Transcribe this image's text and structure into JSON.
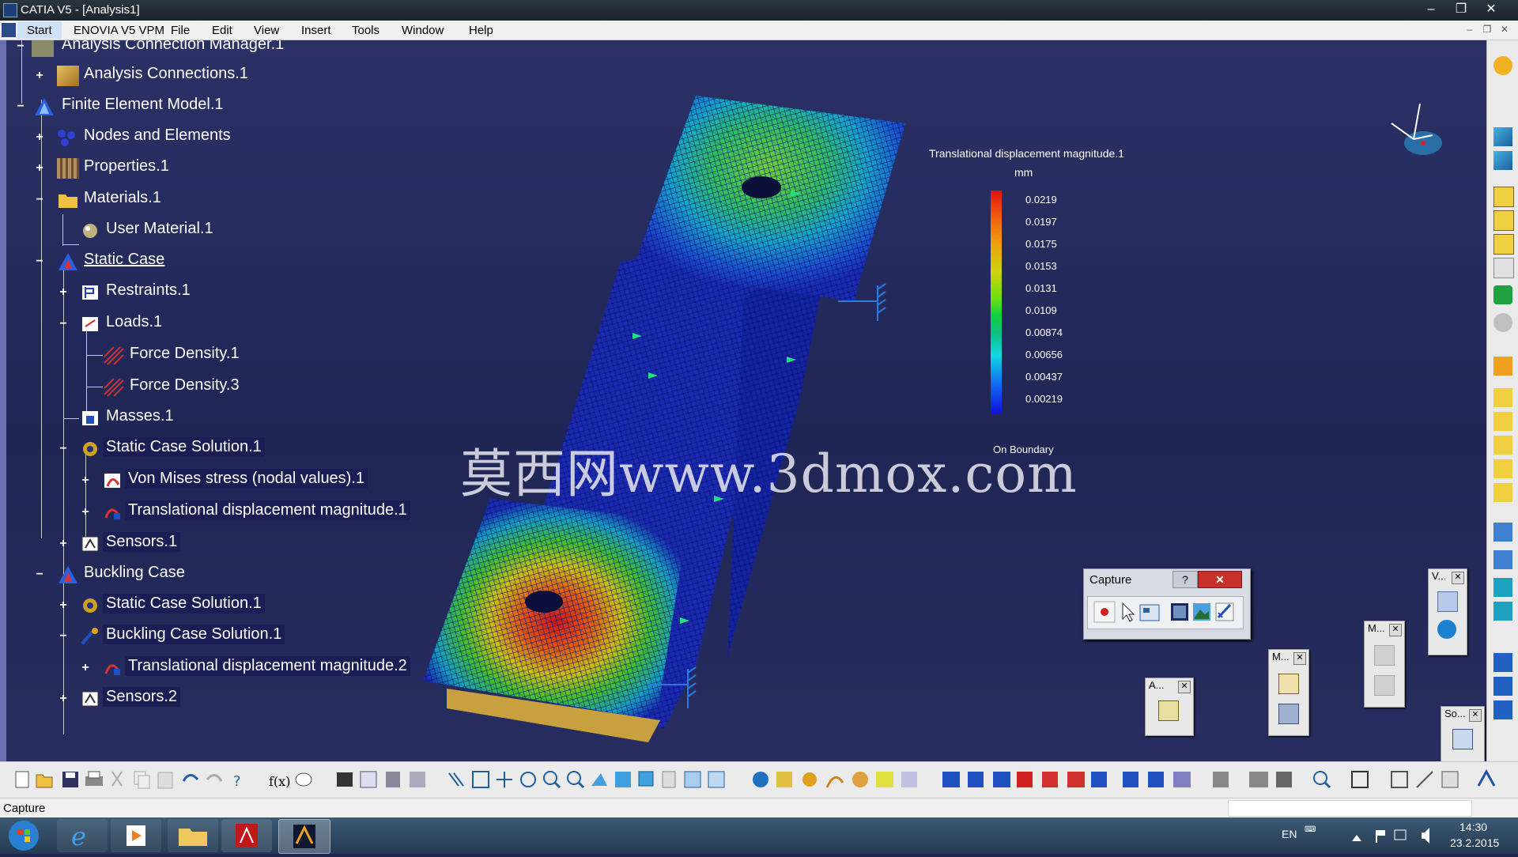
{
  "window": {
    "title": "CATIA V5 - [Analysis1]",
    "controls": {
      "minimize": "–",
      "maximize": "❐",
      "close": "✕"
    }
  },
  "menubar": {
    "items": [
      "Start",
      "ENOVIA V5 VPM",
      "File",
      "Edit",
      "View",
      "Insert",
      "Tools",
      "Window",
      "Help"
    ],
    "mdi_controls": {
      "minimize": "–",
      "restore": "❐",
      "close": "✕"
    }
  },
  "tree": {
    "nodes": [
      {
        "label": "Analysis Connection Manager.1",
        "icon": "analysis-connection-manager-icon"
      },
      {
        "label": "Analysis Connections.1",
        "icon": "analysis-connections-icon"
      },
      {
        "label": "Finite Element Model.1",
        "icon": "finite-element-model-icon"
      },
      {
        "label": "Nodes and Elements",
        "icon": "nodes-elements-icon"
      },
      {
        "label": "Properties.1",
        "icon": "properties-icon"
      },
      {
        "label": "Materials.1",
        "icon": "materials-folder-icon"
      },
      {
        "label": "User Material.1",
        "icon": "user-material-icon"
      },
      {
        "label": "Static Case",
        "icon": "static-case-icon"
      },
      {
        "label": "Restraints.1",
        "icon": "restraints-icon"
      },
      {
        "label": "Loads.1",
        "icon": "loads-icon"
      },
      {
        "label": "Force Density.1",
        "icon": "force-density-icon"
      },
      {
        "label": "Force Density.3",
        "icon": "force-density-icon"
      },
      {
        "label": "Masses.1",
        "icon": "masses-icon"
      },
      {
        "label": "Static Case Solution.1",
        "icon": "static-solution-icon"
      },
      {
        "label": "Von Mises stress (nodal values).1",
        "icon": "von-mises-image-icon"
      },
      {
        "label": "Translational displacement magnitude.1",
        "icon": "displacement-image-icon"
      },
      {
        "label": "Sensors.1",
        "icon": "sensors-icon"
      },
      {
        "label": "Buckling Case",
        "icon": "buckling-case-icon"
      },
      {
        "label": "Static Case Solution.1",
        "icon": "static-solution-icon"
      },
      {
        "label": "Buckling Case Solution.1",
        "icon": "buckling-solution-icon"
      },
      {
        "label": "Translational displacement magnitude.2",
        "icon": "displacement-image-icon"
      },
      {
        "label": "Sensors.2",
        "icon": "sensors-icon"
      }
    ],
    "expanders": {
      "plus": "+",
      "minus": "−"
    }
  },
  "legend": {
    "title": "Translational displacement magnitude.1",
    "unit": "mm",
    "values": [
      "0.0219",
      "0.0197",
      "0.0175",
      "0.0153",
      "0.0131",
      "0.0109",
      "0.00874",
      "0.00656",
      "0.00437",
      "0.00219"
    ],
    "footer": "On Boundary"
  },
  "watermark": "莫西网www.3dmox.com",
  "capture": {
    "title": "Capture",
    "help": "?",
    "close": "✕",
    "tools": [
      "record-icon",
      "select-arrow-icon",
      "capture-settings-icon",
      "capture-image-icon",
      "album-icon",
      "options-icon"
    ]
  },
  "floating_toolbars": [
    {
      "title": "V...",
      "close": "✕"
    },
    {
      "title": "M...",
      "close": "✕"
    },
    {
      "title": "M...",
      "close": "✕"
    },
    {
      "title": "A...",
      "close": "✕"
    },
    {
      "title": "So...",
      "close": "✕"
    }
  ],
  "statusbar": {
    "text": "Capture"
  },
  "taskbar": {
    "language": "EN",
    "time": "14:30",
    "date": "23.2.2015"
  },
  "colors": {
    "viewport_bg": "#222a5c",
    "mesh_blue": "#1a2aa8",
    "legend_max": "#e01010",
    "legend_min": "#1010e0",
    "capture_close": "#c8302a"
  }
}
